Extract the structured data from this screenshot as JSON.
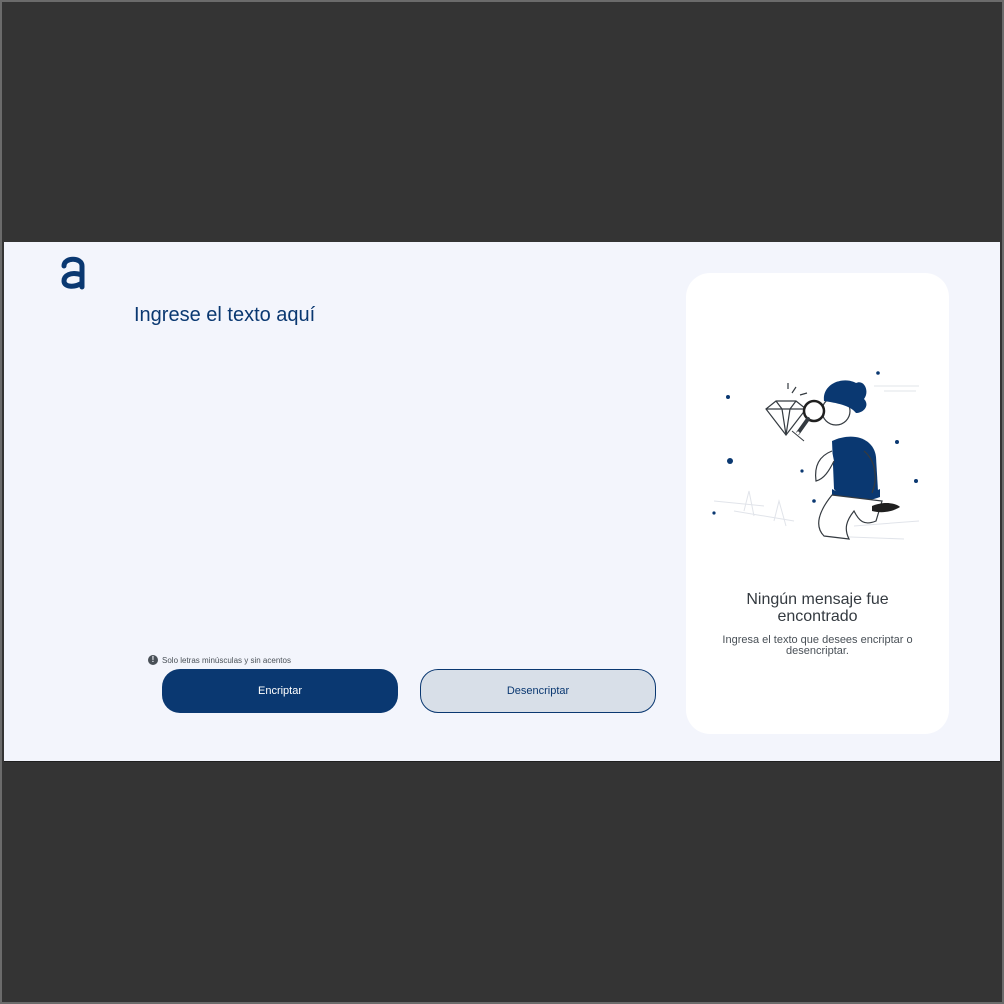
{
  "app": {
    "logo_icon": "alura-a-logo-icon",
    "brand_color": "#0a3871"
  },
  "input": {
    "placeholder": "Ingrese el texto aquí",
    "value": ""
  },
  "hint": {
    "icon": "info-icon",
    "text": "Solo letras minúsculas y sin acentos"
  },
  "buttons": {
    "encrypt_label": "Encriptar",
    "decrypt_label": "Desencriptar"
  },
  "output": {
    "illustration": "person-with-magnifying-glass-illustration",
    "title": "Ningún mensaje fue encontrado",
    "subtitle": "Ingresa el texto que desees encriptar o desencriptar."
  }
}
